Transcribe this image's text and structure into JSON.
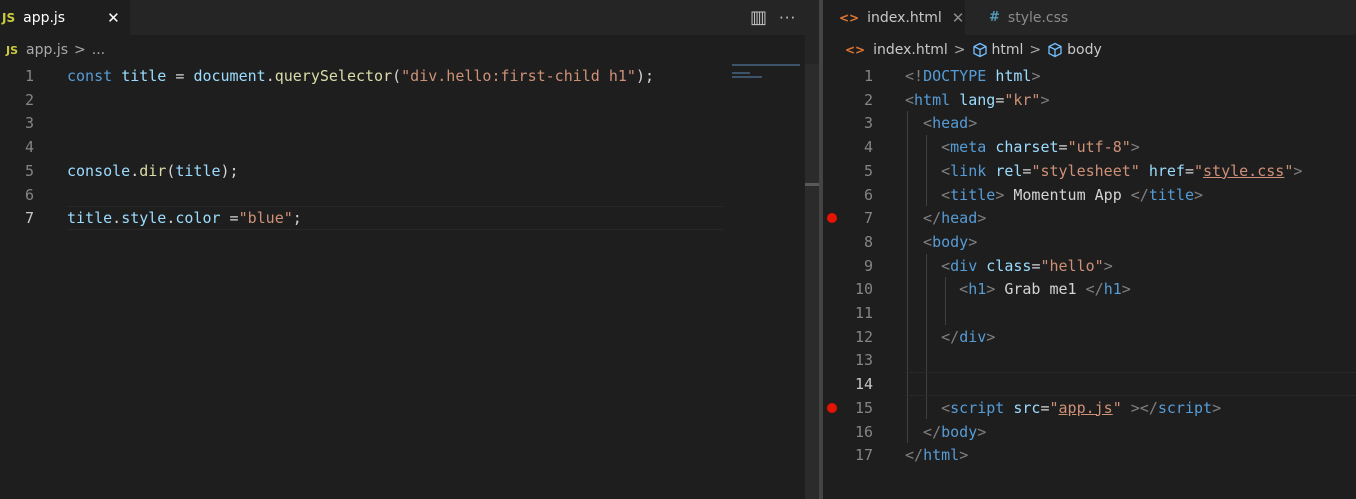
{
  "left_editor": {
    "tab": {
      "icon": "JS",
      "label": "app.js",
      "close": "✕"
    },
    "actions": {
      "split": "▥",
      "more": "···"
    },
    "breadcrumb": {
      "icon": "JS",
      "file": "app.js",
      "sep": ">",
      "ellipsis": "..."
    },
    "lines": [
      {
        "n": "1",
        "tokens": [
          [
            "kw",
            "const "
          ],
          [
            "var",
            "title"
          ],
          [
            "pun",
            " = "
          ],
          [
            "var",
            "document"
          ],
          [
            "pun",
            "."
          ],
          [
            "fn",
            "querySelector"
          ],
          [
            "pun",
            "("
          ],
          [
            "str",
            "\"div.hello:first-child h1\""
          ],
          [
            "pun",
            ");"
          ]
        ]
      },
      {
        "n": "2",
        "tokens": []
      },
      {
        "n": "3",
        "tokens": []
      },
      {
        "n": "4",
        "tokens": []
      },
      {
        "n": "5",
        "tokens": [
          [
            "var",
            "console"
          ],
          [
            "pun",
            "."
          ],
          [
            "fn",
            "dir"
          ],
          [
            "pun",
            "("
          ],
          [
            "var",
            "title"
          ],
          [
            "pun",
            ");"
          ]
        ]
      },
      {
        "n": "6",
        "tokens": []
      },
      {
        "n": "7",
        "tokens": [
          [
            "var",
            "title"
          ],
          [
            "pun",
            "."
          ],
          [
            "var",
            "style"
          ],
          [
            "pun",
            "."
          ],
          [
            "var",
            "color"
          ],
          [
            "pun",
            " ="
          ],
          [
            "str",
            "\"blue\""
          ],
          [
            "pun",
            ";"
          ]
        ]
      }
    ]
  },
  "right_editor": {
    "tabs": [
      {
        "icon": "<>",
        "label": "index.html",
        "close": "✕",
        "active": true
      },
      {
        "icon": "#",
        "label": "style.css",
        "active": false
      }
    ],
    "breadcrumb": {
      "icon": "<>",
      "file": "index.html",
      "sep": ">",
      "node1": "html",
      "node2": "body"
    },
    "lines": [
      {
        "n": "1",
        "tokens": [
          [
            "brk",
            "<!"
          ],
          [
            "tag",
            "DOCTYPE "
          ],
          [
            "attr",
            "html"
          ],
          [
            "brk",
            ">"
          ]
        ]
      },
      {
        "n": "2",
        "tokens": [
          [
            "brk",
            "<"
          ],
          [
            "tag",
            "html "
          ],
          [
            "attr",
            "lang"
          ],
          [
            "plain",
            "="
          ],
          [
            "str",
            "\"kr\""
          ],
          [
            "brk",
            ">"
          ]
        ]
      },
      {
        "n": "3",
        "tokens": [
          [
            "brk",
            "  <"
          ],
          [
            "tag",
            "head"
          ],
          [
            "brk",
            ">"
          ]
        ]
      },
      {
        "n": "4",
        "tokens": [
          [
            "brk",
            "    <"
          ],
          [
            "tag",
            "meta "
          ],
          [
            "attr",
            "charset"
          ],
          [
            "plain",
            "="
          ],
          [
            "str",
            "\"utf-8\""
          ],
          [
            "brk",
            ">"
          ]
        ]
      },
      {
        "n": "5",
        "tokens": [
          [
            "brk",
            "    <"
          ],
          [
            "tag",
            "link "
          ],
          [
            "attr",
            "rel"
          ],
          [
            "plain",
            "="
          ],
          [
            "str",
            "\"stylesheet\" "
          ],
          [
            "attr",
            "href"
          ],
          [
            "plain",
            "="
          ],
          [
            "str",
            "\""
          ],
          [
            "link",
            "style.css"
          ],
          [
            "str",
            "\""
          ],
          [
            "brk",
            ">"
          ]
        ]
      },
      {
        "n": "6",
        "tokens": [
          [
            "brk",
            "    <"
          ],
          [
            "tag",
            "title"
          ],
          [
            "brk",
            "> "
          ],
          [
            "plain",
            "Momentum App "
          ],
          [
            "brk",
            "</"
          ],
          [
            "tag",
            "title"
          ],
          [
            "brk",
            ">"
          ]
        ]
      },
      {
        "n": "7",
        "tokens": [
          [
            "brk",
            "  </"
          ],
          [
            "tag",
            "head"
          ],
          [
            "brk",
            ">"
          ]
        ]
      },
      {
        "n": "8",
        "tokens": [
          [
            "brk",
            "  <"
          ],
          [
            "tag",
            "body"
          ],
          [
            "brk",
            ">"
          ]
        ]
      },
      {
        "n": "9",
        "tokens": [
          [
            "brk",
            "    <"
          ],
          [
            "tag",
            "div "
          ],
          [
            "attr",
            "class"
          ],
          [
            "plain",
            "="
          ],
          [
            "str",
            "\"hello\""
          ],
          [
            "brk",
            ">"
          ]
        ]
      },
      {
        "n": "10",
        "tokens": [
          [
            "brk",
            "      <"
          ],
          [
            "tag",
            "h1"
          ],
          [
            "brk",
            "> "
          ],
          [
            "plain",
            "Grab me1 "
          ],
          [
            "brk",
            "</"
          ],
          [
            "tag",
            "h1"
          ],
          [
            "brk",
            ">"
          ]
        ]
      },
      {
        "n": "11",
        "tokens": []
      },
      {
        "n": "12",
        "tokens": [
          [
            "brk",
            "    </"
          ],
          [
            "tag",
            "div"
          ],
          [
            "brk",
            ">"
          ]
        ]
      },
      {
        "n": "13",
        "tokens": []
      },
      {
        "n": "14",
        "tokens": []
      },
      {
        "n": "15",
        "tokens": [
          [
            "brk",
            "    <"
          ],
          [
            "tag",
            "script "
          ],
          [
            "attr",
            "src"
          ],
          [
            "plain",
            "="
          ],
          [
            "str",
            "\""
          ],
          [
            "link",
            "app.js"
          ],
          [
            "str",
            "\" "
          ],
          [
            "brk",
            "></"
          ],
          [
            "tag",
            "script"
          ],
          [
            "brk",
            ">"
          ]
        ]
      },
      {
        "n": "16",
        "tokens": [
          [
            "brk",
            "  </"
          ],
          [
            "tag",
            "body"
          ],
          [
            "brk",
            ">"
          ]
        ]
      },
      {
        "n": "17",
        "tokens": [
          [
            "brk",
            "</"
          ],
          [
            "tag",
            "html"
          ],
          [
            "brk",
            ">"
          ]
        ]
      }
    ]
  },
  "colors": {
    "background": "#1e1e1e",
    "tabbar": "#252526",
    "keyword": "#569cd6",
    "variable": "#9cdcfe",
    "function": "#dcdcaa",
    "string": "#ce9178",
    "breakpoint": "#e51400",
    "js_icon": "#cbcb41",
    "html_icon": "#e37933",
    "css_icon": "#519aba"
  }
}
